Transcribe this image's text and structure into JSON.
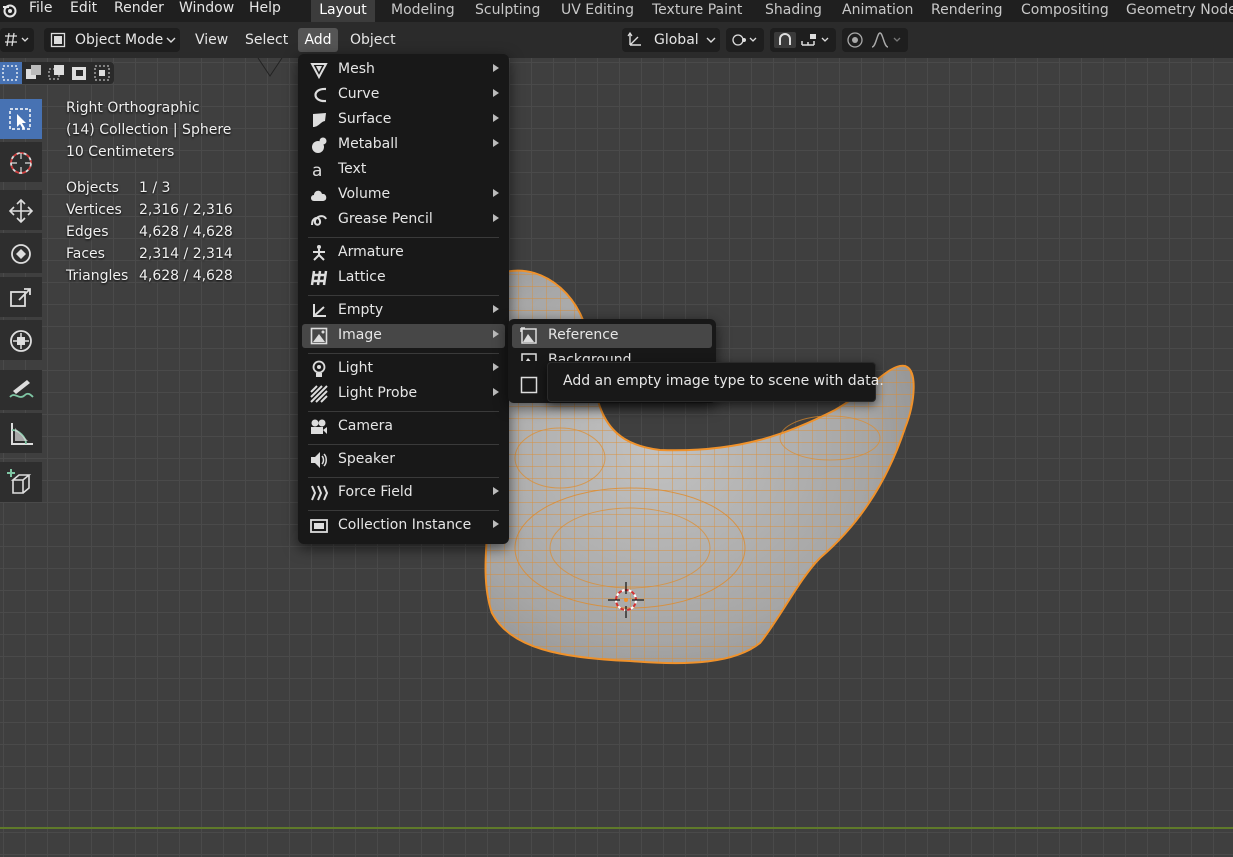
{
  "menubar": {
    "items": [
      "File",
      "Edit",
      "Render",
      "Window",
      "Help"
    ],
    "workspaces": [
      "Layout",
      "Modeling",
      "Sculpting",
      "UV Editing",
      "Texture Paint",
      "Shading",
      "Animation",
      "Rendering",
      "Compositing",
      "Geometry Nodes"
    ],
    "active_workspace": "Layout"
  },
  "header": {
    "mode": "Object Mode",
    "menus": [
      "View",
      "Select",
      "Add",
      "Object"
    ],
    "transform_orientation": "Global"
  },
  "overlay": {
    "view_name": "Right Orthographic",
    "collection": "(14) Collection | Sphere",
    "scale": "10 Centimeters",
    "stats": [
      {
        "label": "Objects",
        "value": "1 / 3"
      },
      {
        "label": "Vertices",
        "value": "2,316 / 2,316"
      },
      {
        "label": "Edges",
        "value": "4,628 / 4,628"
      },
      {
        "label": "Faces",
        "value": "2,314 / 2,314"
      },
      {
        "label": "Triangles",
        "value": "4,628 / 4,628"
      }
    ]
  },
  "add_menu": {
    "items": [
      {
        "label": "Mesh",
        "icon": "mesh-icon",
        "submenu": true
      },
      {
        "label": "Curve",
        "icon": "curve-icon",
        "submenu": true
      },
      {
        "label": "Surface",
        "icon": "surface-icon",
        "submenu": true
      },
      {
        "label": "Metaball",
        "icon": "metaball-icon",
        "submenu": true
      },
      {
        "label": "Text",
        "icon": "text-icon",
        "submenu": false
      },
      {
        "label": "Volume",
        "icon": "volume-icon",
        "submenu": true
      },
      {
        "label": "Grease Pencil",
        "icon": "grease-pencil-icon",
        "submenu": true
      },
      {
        "label": "Armature",
        "icon": "armature-icon",
        "submenu": false
      },
      {
        "label": "Lattice",
        "icon": "lattice-icon",
        "submenu": false
      },
      {
        "label": "Empty",
        "icon": "empty-icon",
        "submenu": true
      },
      {
        "label": "Image",
        "icon": "image-icon",
        "submenu": true
      },
      {
        "label": "Light",
        "icon": "light-icon",
        "submenu": true
      },
      {
        "label": "Light Probe",
        "icon": "light-probe-icon",
        "submenu": true
      },
      {
        "label": "Camera",
        "icon": "camera-icon",
        "submenu": false
      },
      {
        "label": "Speaker",
        "icon": "speaker-icon",
        "submenu": false
      },
      {
        "label": "Force Field",
        "icon": "force-field-icon",
        "submenu": true
      },
      {
        "label": "Collection Instance",
        "icon": "collection-instance-icon",
        "submenu": true
      }
    ],
    "highlighted": "Image"
  },
  "image_submenu": {
    "items": [
      {
        "label": "Reference",
        "icon": "image-reference-icon"
      },
      {
        "label": "Background",
        "icon": "image-background-icon"
      },
      {
        "label": "",
        "icon": "image-empty-icon"
      }
    ],
    "highlighted": "Reference"
  },
  "tooltip": {
    "text": "Add an empty image type to scene with data."
  },
  "colors": {
    "accent": "#4772b3",
    "selection_wire": "#f0922b",
    "menu_bg": "#181818",
    "viewport_bg": "#3f3f3f"
  }
}
